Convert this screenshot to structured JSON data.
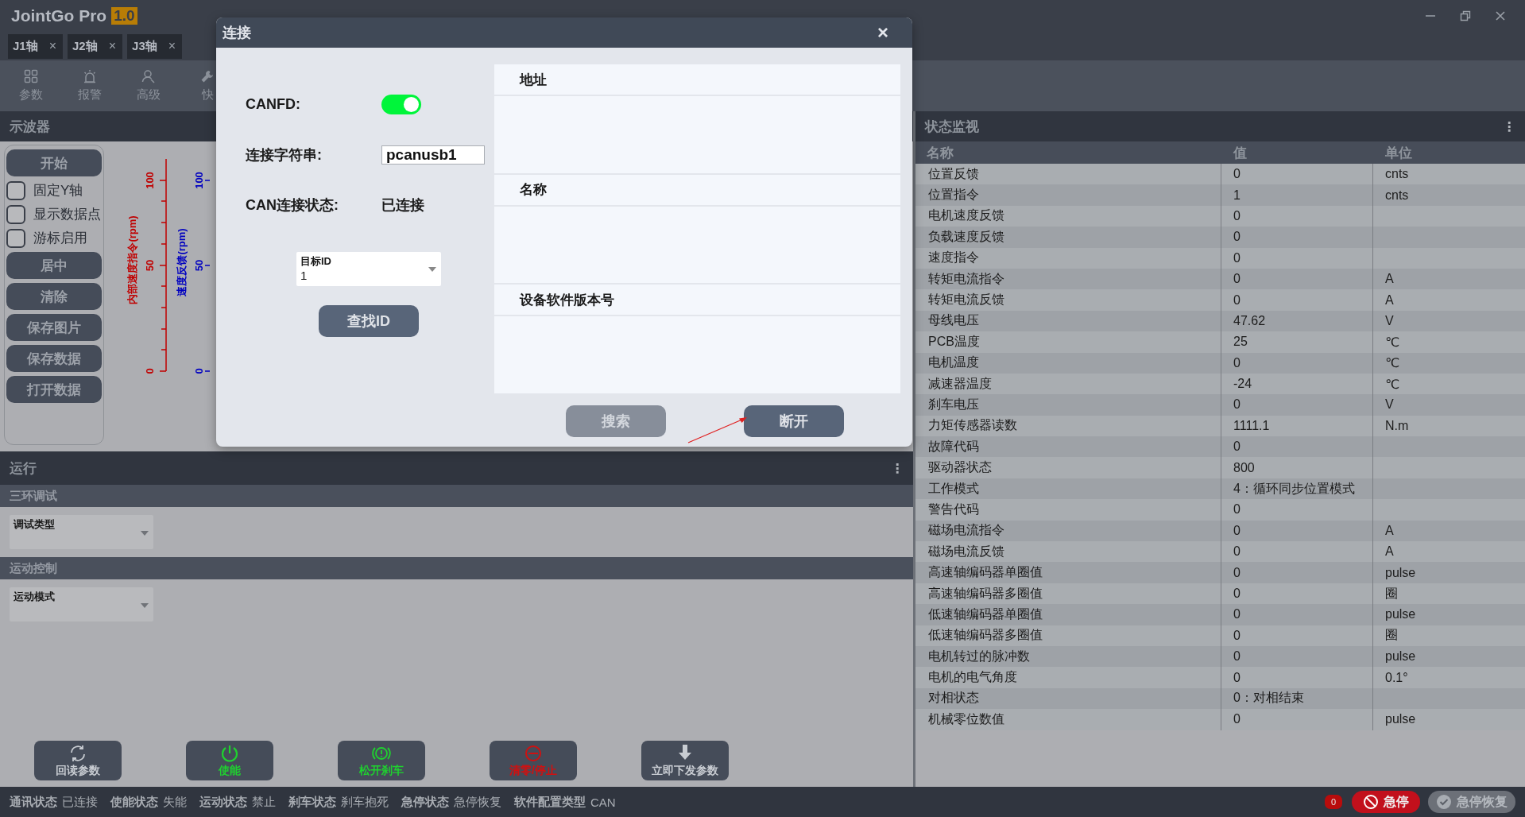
{
  "window": {
    "title": "JointGo Pro",
    "version": "1.0"
  },
  "tabs": [
    {
      "label": "J1轴",
      "close": "×"
    },
    {
      "label": "J2轴",
      "close": "×"
    },
    {
      "label": "J3轴",
      "close": "×"
    }
  ],
  "toolbar": [
    {
      "label": "参数",
      "kind": "grid"
    },
    {
      "label": "报警",
      "kind": "alarm"
    },
    {
      "label": "高级",
      "kind": "search-user"
    },
    {
      "label": "快",
      "kind": "wrench"
    }
  ],
  "oscilloscope": {
    "title": "示波器",
    "buttons_top": [
      "开始"
    ],
    "checkboxes": [
      {
        "label": "固定Y轴",
        "checked": false
      },
      {
        "label": "显示数据点",
        "checked": false
      },
      {
        "label": "游标启用",
        "checked": false
      }
    ],
    "buttons_bottom": [
      "居中",
      "清除",
      "保存图片",
      "保存数据",
      "打开数据"
    ],
    "axes": [
      {
        "label": "内部速度指令(rpm)",
        "color": "#c00000",
        "ticks": [
          "100",
          "50",
          "0"
        ]
      },
      {
        "label": "速度反馈(rpm)",
        "color": "#0000c0",
        "ticks": [
          "100",
          "50",
          "0"
        ]
      }
    ]
  },
  "run": {
    "title": "运行",
    "menu": "⋮",
    "sections": [
      {
        "title": "三环调试",
        "dropdown": "调试类型"
      },
      {
        "title": "运动控制",
        "dropdown": "运动模式"
      }
    ],
    "buttons": [
      {
        "label": "回读参数",
        "kind": "refresh",
        "color": "#c8ccd2"
      },
      {
        "label": "使能",
        "kind": "power",
        "color": "#1fd12f"
      },
      {
        "label": "松开刹车",
        "kind": "brake",
        "color": "#1fd12f"
      },
      {
        "label": "清零/停止",
        "kind": "stop",
        "color": "#d01010"
      },
      {
        "label": "立即下发参数",
        "kind": "download",
        "color": "#c8ccd2"
      }
    ]
  },
  "monitor": {
    "title": "状态监视",
    "menu": "⋮",
    "columns": [
      "名称",
      "值",
      "单位"
    ],
    "rows": [
      {
        "name": "位置反馈",
        "value": "0",
        "unit": "cnts"
      },
      {
        "name": "位置指令",
        "value": "1",
        "unit": "cnts"
      },
      {
        "name": "电机速度反馈",
        "value": "0"
      },
      {
        "name": "负载速度反馈",
        "value": "0"
      },
      {
        "name": "速度指令",
        "value": "0"
      },
      {
        "name": "转矩电流指令",
        "value": "0",
        "unit": "A"
      },
      {
        "name": "转矩电流反馈",
        "value": "0",
        "unit": "A"
      },
      {
        "name": "母线电压",
        "value": "47.62",
        "unit": "V"
      },
      {
        "name": "PCB温度",
        "value": "25",
        "unit": "℃"
      },
      {
        "name": "电机温度",
        "value": "0",
        "unit": "℃"
      },
      {
        "name": "减速器温度",
        "value": "-24",
        "unit": "℃"
      },
      {
        "name": "刹车电压",
        "value": "0",
        "unit": "V"
      },
      {
        "name": "力矩传感器读数",
        "value": "1111.1",
        "unit": "N.m"
      },
      {
        "name": "故障代码",
        "value": "0"
      },
      {
        "name": "驱动器状态",
        "value": "800"
      },
      {
        "name": "工作模式",
        "value": "4：循环同步位置模式"
      },
      {
        "name": "警告代码",
        "value": "0"
      },
      {
        "name": "磁场电流指令",
        "value": "0",
        "unit": "A"
      },
      {
        "name": "磁场电流反馈",
        "value": "0",
        "unit": "A"
      },
      {
        "name": "高速轴编码器单圈值",
        "value": "0",
        "unit": "pulse"
      },
      {
        "name": "高速轴编码器多圈值",
        "value": "0",
        "unit": "圈"
      },
      {
        "name": "低速轴编码器单圈值",
        "value": "0",
        "unit": "pulse"
      },
      {
        "name": "低速轴编码器多圈值",
        "value": "0",
        "unit": "圈"
      },
      {
        "name": "电机转过的脉冲数",
        "value": "0",
        "unit": "pulse"
      },
      {
        "name": "电机的电气角度",
        "value": "0",
        "unit": "0.1°"
      },
      {
        "name": "对相状态",
        "value": "0：对相结束"
      },
      {
        "name": "机械零位数值",
        "value": "0",
        "unit": "pulse"
      }
    ]
  },
  "status_bar": {
    "items": [
      {
        "label": "通讯状态",
        "value": "已连接"
      },
      {
        "label": "使能状态",
        "value": "失能"
      },
      {
        "label": "运动状态",
        "value": "禁止"
      },
      {
        "label": "刹车状态",
        "value": "刹车抱死"
      },
      {
        "label": "急停状态",
        "value": "急停恢复"
      },
      {
        "label": "软件配置类型",
        "value": "CAN"
      }
    ],
    "badge": "0",
    "estop": "急停",
    "estop_reset": "急停恢复"
  },
  "dialog": {
    "title": "连接",
    "close": "×",
    "canfd_label": "CANFD:",
    "canfd_on": true,
    "conn_label": "连接字符串:",
    "conn_value": "pcanusb1",
    "state_label": "CAN连接状态:",
    "state_value": "已连接",
    "target_label": "目标ID",
    "target_value": "1",
    "find_button": "查找ID",
    "list_headers": [
      "地址",
      "名称",
      "设备软件版本号"
    ],
    "search_button": {
      "label": "搜索",
      "disabled": true
    },
    "disconnect_button": {
      "label": "断开",
      "disabled": false
    }
  }
}
